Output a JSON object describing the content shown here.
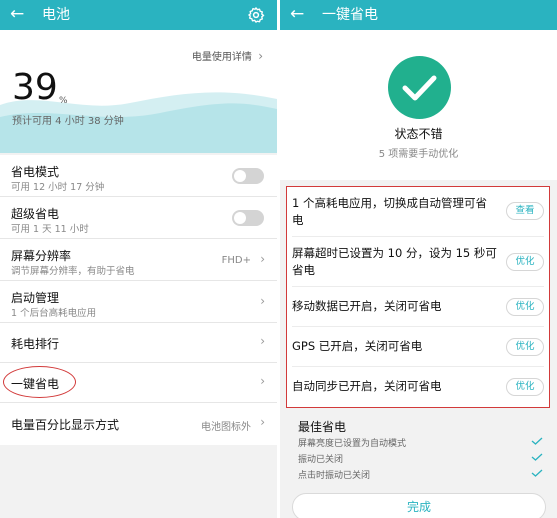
{
  "battery_screen": {
    "title": "电池",
    "back_icon": "back-arrow-icon",
    "settings_icon": "gear-icon",
    "usage_details_link": "电量使用详情",
    "battery_percent": "39",
    "percent_sign": "%",
    "estimated_remaining": "预计可用 4 小时 38 分钟",
    "items": [
      {
        "title": "省电模式",
        "subtitle": "可用 12 小时 17 分钟",
        "control": "toggle",
        "on": false
      },
      {
        "title": "超级省电",
        "subtitle": "可用 1 天 11 小时",
        "control": "toggle",
        "on": false
      },
      {
        "title": "屏幕分辨率",
        "subtitle": "调节屏幕分辨率，有助于省电",
        "value": "FHD+",
        "control": "chevron"
      },
      {
        "title": "启动管理",
        "subtitle": "1 个后台高耗电应用",
        "control": "chevron"
      },
      {
        "title": "耗电排行",
        "control": "chevron"
      },
      {
        "title": "一键省电",
        "control": "chevron"
      },
      {
        "title": "电量百分比显示方式",
        "value": "电池图标外",
        "control": "chevron"
      }
    ]
  },
  "optimize_screen": {
    "title": "一键省电",
    "back_icon": "back-arrow-icon",
    "status_title": "状态不错",
    "status_subtitle": "5 项需要手动优化",
    "manual_items": [
      {
        "text": "1 个高耗电应用，切换成自动管理可省电",
        "action": "查看"
      },
      {
        "text": "屏幕超时已设置为 10 分，设为 15 秒可省电",
        "action": "优化"
      },
      {
        "text": "移动数据已开启，关闭可省电",
        "action": "优化"
      },
      {
        "text": "GPS 已开启，关闭可省电",
        "action": "优化"
      },
      {
        "text": "自动同步已开启，关闭可省电",
        "action": "优化"
      }
    ],
    "best_title": "最佳省电",
    "best_items": [
      "屏幕亮度已设置为自动模式",
      "振动已关闭",
      "点击时振动已关闭"
    ],
    "done_button": "完成"
  },
  "colors": {
    "accent": "#2ab3c0",
    "success": "#21b08e",
    "annotation": "#d23a3a"
  }
}
